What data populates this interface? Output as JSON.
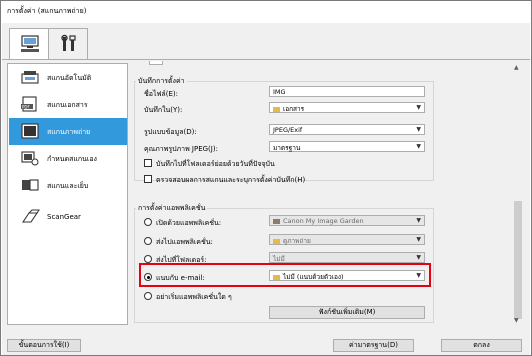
{
  "window": {
    "title": "การตั้งค่า (สแกนภาพถ่าย)"
  },
  "tabs": [
    {
      "icon": "scanner-pc-icon"
    },
    {
      "icon": "tools-icon"
    }
  ],
  "sidebar": {
    "items": [
      {
        "label": "สแกนอัตโนมัติ",
        "icon": "auto-scan-icon"
      },
      {
        "label": "สแกนเอกสาร",
        "icon": "pdf-document-icon"
      },
      {
        "label": "สแกนภาพถ่าย",
        "icon": "photo-icon"
      },
      {
        "label": "กำหนดสแกนเอง",
        "icon": "custom-scan-icon"
      },
      {
        "label": "สแกนและเย็บ",
        "icon": "stitch-icon"
      },
      {
        "label": "ScanGear",
        "icon": "scangear-icon"
      }
    ]
  },
  "save": {
    "section_title": "บันทึกการตั้งค่า",
    "filename_label": "ชื่อไฟล์(E):",
    "filename_value": "IMG",
    "savein_label": "บันทึกใน(Y):",
    "savein_value": "เอกสาร",
    "format_label": "รูปแบบข้อมูล(D):",
    "format_value": "JPEG/Exif",
    "jpeg_label": "คุณภาพรูปภาพ JPEG(J):",
    "jpeg_value": "มาตรฐาน",
    "subfolder_label": "บันทึกไปที่โฟลเดอร์ย่อยด้วยวันที่ปัจจุบัน",
    "check_label": "ตรวจสอบผลการสแกนและระบุการตั้งค่าบันทึก(H)"
  },
  "app": {
    "section_title": "การตั้งค่าแอพพลิเคชั่น",
    "open_label": "เปิดด้วยแอพพลิเคชั่น:",
    "open_value": "Canon My Image Garden",
    "send_label": "ส่งไปแอพพลิเคชั่น:",
    "send_value": "ดูภาพถ่าย",
    "folder_label": "ส่งไปที่โฟลเดอร์:",
    "folder_value": "ไม่มี",
    "email_label": "แนบกับ e-mail:",
    "email_value": "ไม่มี (แนบด้วยตัวเอง)",
    "none_label": "อย่าเริ่มแอพพลิเคชั่นใด ๆ",
    "more_button": "ฟังก์ชันเพิ่มเติม(M)"
  },
  "footer": {
    "instructions": "ขั้นตอนการใช้(I)",
    "defaults": "ค่ามาตรฐาน(D)",
    "ok": "ตกลง"
  },
  "colors": {
    "selected": "#3399dd",
    "highlight": "#e60012"
  }
}
